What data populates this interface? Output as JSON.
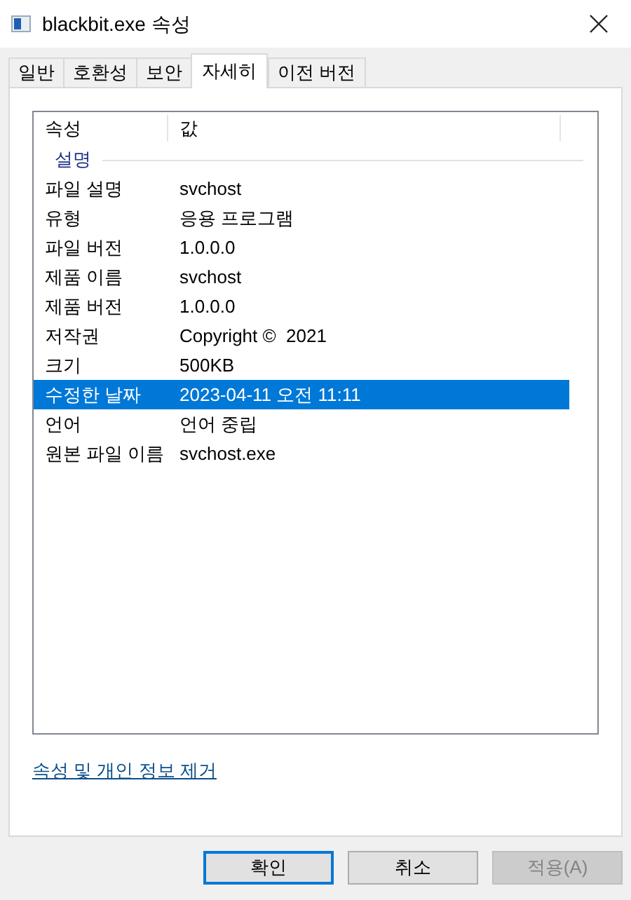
{
  "window": {
    "title": "blackbit.exe 속성"
  },
  "tabs": [
    {
      "label": "일반",
      "selected": false
    },
    {
      "label": "호환성",
      "selected": false
    },
    {
      "label": "보안",
      "selected": false
    },
    {
      "label": "자세히",
      "selected": true
    },
    {
      "label": "이전 버전",
      "selected": false
    }
  ],
  "table": {
    "columns": [
      "속성",
      "값"
    ],
    "group": "설명",
    "rows": [
      {
        "name": "파일 설명",
        "value": "svchost",
        "selected": false
      },
      {
        "name": "유형",
        "value": "응용 프로그램",
        "selected": false
      },
      {
        "name": "파일 버전",
        "value": "1.0.0.0",
        "selected": false
      },
      {
        "name": "제품 이름",
        "value": "svchost",
        "selected": false
      },
      {
        "name": "제품 버전",
        "value": "1.0.0.0",
        "selected": false
      },
      {
        "name": "저작권",
        "value": "Copyright ©  2021",
        "selected": false
      },
      {
        "name": "크기",
        "value": "500KB",
        "selected": false
      },
      {
        "name": "수정한 날짜",
        "value": "2023-04-11 오전 11:11",
        "selected": true
      },
      {
        "name": "언어",
        "value": "언어 중립",
        "selected": false
      },
      {
        "name": "원본 파일 이름",
        "value": "svchost.exe",
        "selected": false
      }
    ]
  },
  "link": "속성 및 개인 정보 제거",
  "buttons": [
    {
      "label": "확인",
      "default": true,
      "disabled": false
    },
    {
      "label": "취소",
      "default": false,
      "disabled": false
    },
    {
      "label": "적용(A)",
      "default": false,
      "disabled": true
    }
  ]
}
